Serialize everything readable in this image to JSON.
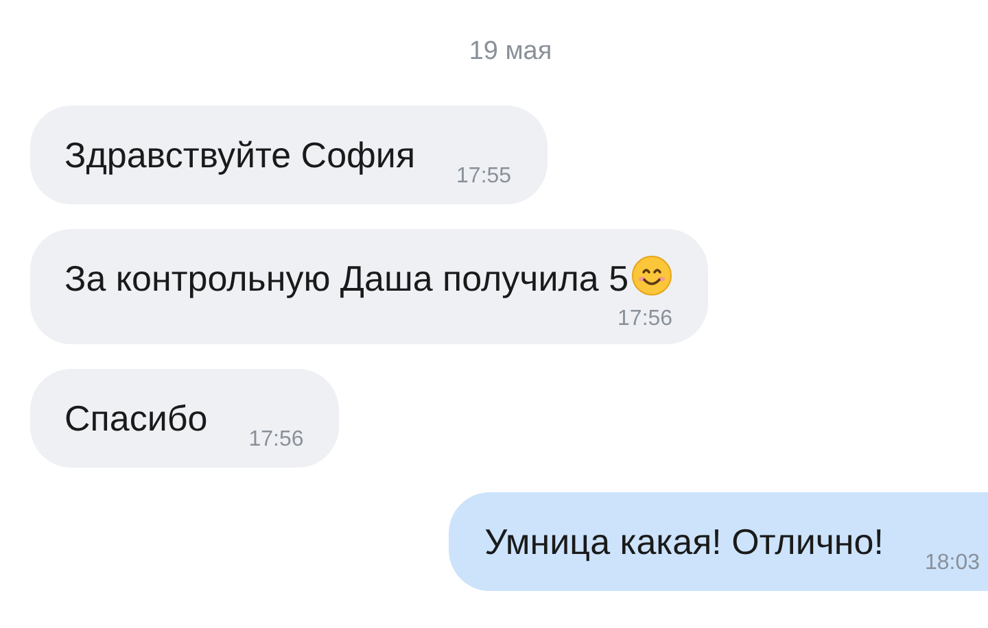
{
  "date": "19 мая",
  "messages": [
    {
      "kind": "incoming",
      "text": "Здравствуйте София",
      "time": "17:55",
      "emoji": false,
      "time_below": false
    },
    {
      "kind": "incoming",
      "text": "За контрольную Даша получила 5",
      "time": "17:56",
      "emoji": true,
      "time_below": true
    },
    {
      "kind": "incoming",
      "text": "Спасибо",
      "time": "17:56",
      "emoji": false,
      "time_below": false
    },
    {
      "kind": "outgoing",
      "text": "Умница какая! Отлично!",
      "time": "18:03",
      "emoji": false,
      "time_below": false
    }
  ]
}
